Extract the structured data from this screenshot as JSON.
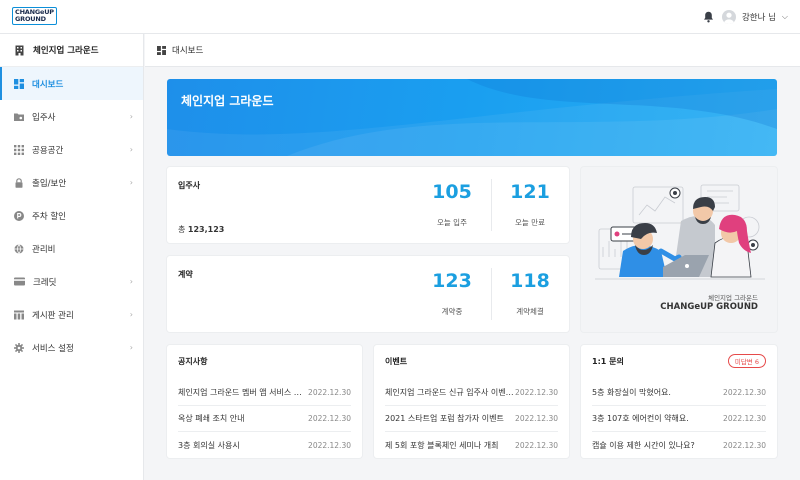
{
  "header": {
    "logo_line1": "CHANGeUP",
    "logo_line2": "GROUND",
    "username": "강한나 님"
  },
  "sidebar": {
    "title": "체인지업 그라운드",
    "items": [
      {
        "label": "대시보드",
        "icon": "dashboard-icon",
        "active": true
      },
      {
        "label": "입주사",
        "icon": "folder-icon"
      },
      {
        "label": "공용공간",
        "icon": "grid-icon"
      },
      {
        "label": "출입/보안",
        "icon": "lock-icon"
      },
      {
        "label": "주차 할인",
        "icon": "parking-icon"
      },
      {
        "label": "관리비",
        "icon": "globe-icon"
      },
      {
        "label": "크레딧",
        "icon": "card-icon"
      },
      {
        "label": "게시판 관리",
        "icon": "board-icon"
      },
      {
        "label": "서비스 설정",
        "icon": "gear-icon"
      }
    ]
  },
  "breadcrumb": {
    "label": "대시보드"
  },
  "banner": {
    "title": "체인지업 그라운드"
  },
  "tenants": {
    "title": "입주사",
    "total_label": "총",
    "total_value": "123,123",
    "stat1_value": "105",
    "stat1_label": "오늘 입주",
    "stat2_value": "121",
    "stat2_label": "오늘 만료"
  },
  "contracts": {
    "title": "계약",
    "stat1_value": "123",
    "stat1_label": "계약중",
    "stat2_value": "118",
    "stat2_label": "계약체결"
  },
  "illustration": {
    "caption1": "체인지업 그라운드",
    "caption2": "CHANGeUP GROUND"
  },
  "notices": {
    "title": "공지사항",
    "rows": [
      {
        "text": "체인지업 그라운드 멤버 앱 서비스 개…",
        "date": "2022.12.30"
      },
      {
        "text": "옥상 폐쇄 조치 안내",
        "date": "2022.12.30"
      },
      {
        "text": "3층 회의실 사용시",
        "date": "2022.12.30"
      }
    ]
  },
  "events": {
    "title": "이벤트",
    "rows": [
      {
        "text": "체인지업 그라운드 신규 입주사 이벤…",
        "date": "2022.12.30"
      },
      {
        "text": "2021 스타트업 포럼 참가자 이벤트",
        "date": "2022.12.30"
      },
      {
        "text": "제 5회 포항 블록체인 세미나 개최",
        "date": "2022.12.30"
      }
    ]
  },
  "inquiries": {
    "title": "1:1 문의",
    "badge": "미답변 6",
    "rows": [
      {
        "text": "5층 화장실이 막혔어요.",
        "date": "2022.12.30"
      },
      {
        "text": "3층 107호 에어컨이 약해요.",
        "date": "2022.12.30"
      },
      {
        "text": "캡슐 이용 제한 시간이 있나요?",
        "date": "2022.12.30"
      }
    ]
  },
  "colors": {
    "accent": "#1e8fe0",
    "badge": "#e64a4a"
  }
}
